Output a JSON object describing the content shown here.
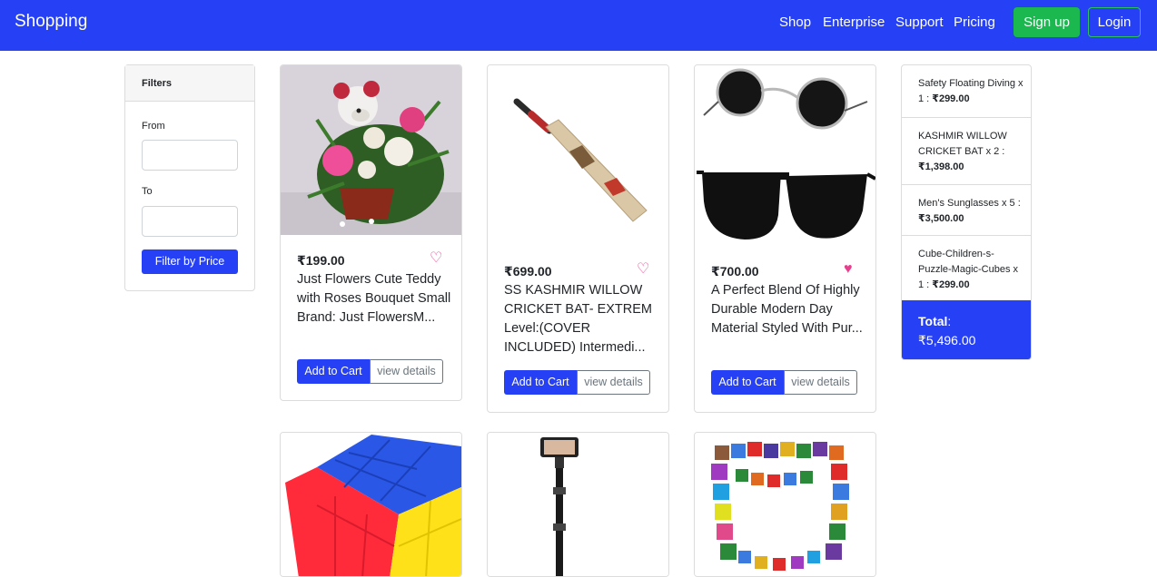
{
  "navbar": {
    "brand": "Shopping",
    "links": [
      "Shop",
      "Enterprise",
      "Support",
      "Pricing"
    ],
    "signup": "Sign up",
    "login": "Login",
    "color": "#2640f5"
  },
  "filters": {
    "title": "Filters",
    "from_label": "From",
    "from_value": "",
    "to_label": "To",
    "to_value": "",
    "button": "Filter by Price"
  },
  "products": [
    {
      "price": "₹199.00",
      "title": "Just Flowers Cute Teddy with Roses Bouquet Small Brand: Just FlowersM...",
      "favorite": false,
      "add": "Add to Cart",
      "view": "view details"
    },
    {
      "price": "₹699.00",
      "title": "SS KASHMIR WILLOW CRICKET BAT- EXTREM Level:(COVER INCLUDED) Intermedi...",
      "favorite": false,
      "add": "Add to Cart",
      "view": "view details"
    },
    {
      "price": "₹700.00",
      "title": "A Perfect Blend Of Highly Durable Modern Day Material Styled With Pur...",
      "favorite": true,
      "add": "Add to Cart",
      "view": "view details"
    },
    {
      "image": "rubiks-cube"
    },
    {
      "image": "selfie-stick-tripod"
    },
    {
      "image": "colored-wooden-blocks"
    }
  ],
  "cart": {
    "items": [
      {
        "name": "Safety Floating Diving x 1 : ",
        "amount": "₹299.00"
      },
      {
        "name": "KASHMIR WILLOW CRICKET BAT x 2 : ",
        "amount": "₹1,398.00"
      },
      {
        "name": "Men's Sunglasses x 5 : ",
        "amount": "₹3,500.00"
      },
      {
        "name": "Cube-Children-s-Puzzle-Magic-Cubes x 1 : ",
        "amount": "₹299.00"
      }
    ],
    "total_label": "Total",
    "total_value": "₹5,496.00"
  },
  "icons": {
    "favorite": "heart-icon"
  },
  "colors": {
    "primary": "#2640f5",
    "success": "#1ab84f",
    "heart": "#e83e8c"
  }
}
